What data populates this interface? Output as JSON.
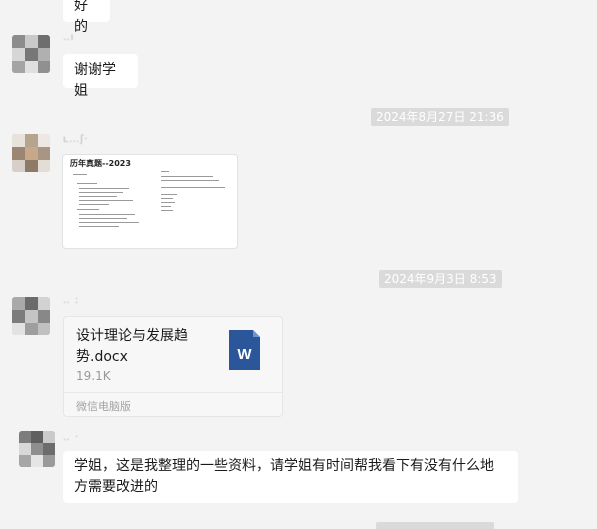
{
  "messages": [
    {
      "text": "好的"
    },
    {
      "text": "谢谢学姐"
    },
    {
      "type": "document_preview",
      "title": "历年真题--2023"
    },
    {
      "type": "file",
      "file_name": "设计理论与发展趋势.docx",
      "file_size": "19.1K",
      "source": "微信电脑版",
      "icon": "word-file-icon"
    },
    {
      "text": "学姐，这是我整理的一些资料，请学姐有时间帮我看下有没有什么地方需要改进的"
    }
  ],
  "timestamps": [
    "2024年8月27日 21:36",
    "2024年9月3日 8:53"
  ],
  "colors": {
    "background": "#f3f3f3",
    "bubble": "#ffffff",
    "timestamp_bg": "#dadada",
    "word_blue": "#2b579a"
  }
}
